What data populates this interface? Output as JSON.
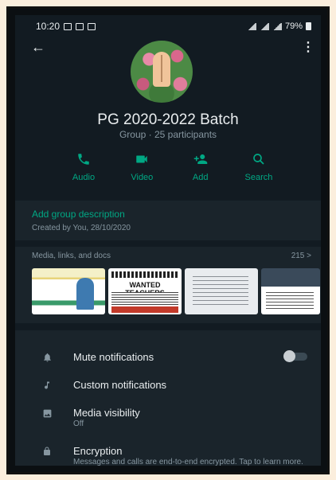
{
  "status_bar": {
    "time": "10:20",
    "battery": "79%",
    "network": "VoLTE"
  },
  "header": {
    "back_icon": "arrow-left-icon",
    "menu_icon": "more-vert-icon"
  },
  "group": {
    "name": "PG 2020-2022 Batch",
    "subtitle": "Group · 25 participants"
  },
  "actions": [
    {
      "label": "Audio",
      "icon": "phone-icon"
    },
    {
      "label": "Video",
      "icon": "video-icon"
    },
    {
      "label": "Add",
      "icon": "add-person-icon"
    },
    {
      "label": "Search",
      "icon": "search-icon"
    }
  ],
  "description": {
    "title": "Add group description",
    "created": "Created by You, 28/10/2020"
  },
  "media": {
    "title": "Media, links, and docs",
    "count": "215 >",
    "thumb2_text": "WANTED TEACHERS"
  },
  "settings": {
    "mute": {
      "label": "Mute notifications"
    },
    "custom": {
      "label": "Custom notifications"
    },
    "visibility": {
      "label": "Media visibility",
      "value": "Off"
    },
    "encryption": {
      "label": "Encryption",
      "description": "Messages and calls are end-to-end encrypted. Tap to learn more."
    }
  },
  "colors": {
    "accent": "#00a884",
    "background": "#121b22",
    "section": "#1a242b"
  }
}
